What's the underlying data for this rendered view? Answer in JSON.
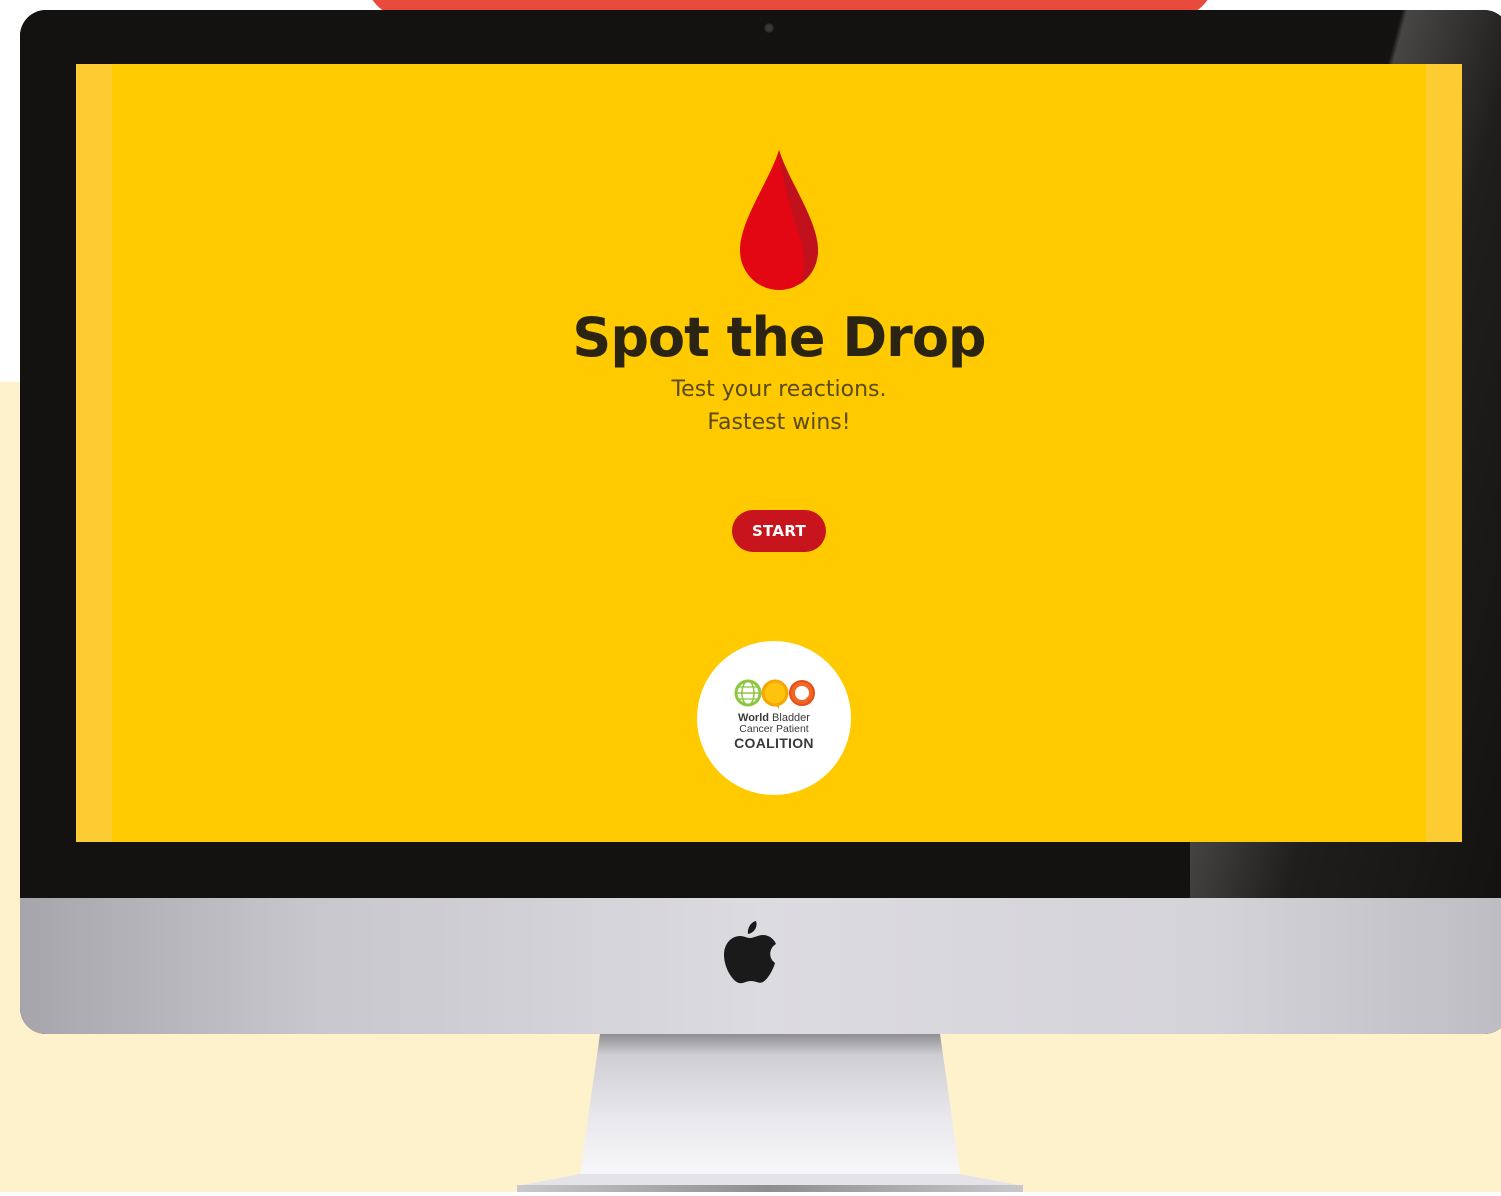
{
  "game": {
    "title": "Spot the Drop",
    "subtitle_line1": "Test your reactions.",
    "subtitle_line2": "Fastest wins!",
    "start_label": "START"
  },
  "sponsor_logo": {
    "line1_bold": "World",
    "line1_rest": " Bladder",
    "line2": "Cancer Patient",
    "line3": "COALITION"
  },
  "colors": {
    "screen_background": "#ffca00",
    "start_button": "#c8141c",
    "drop_red": "#e30613",
    "title_text": "#2b2413",
    "page_cream": "#fef2cc",
    "top_accent": "#e84a3b"
  },
  "icons": {
    "drop": "blood-drop-icon",
    "device_brand": "apple-logo-icon"
  }
}
